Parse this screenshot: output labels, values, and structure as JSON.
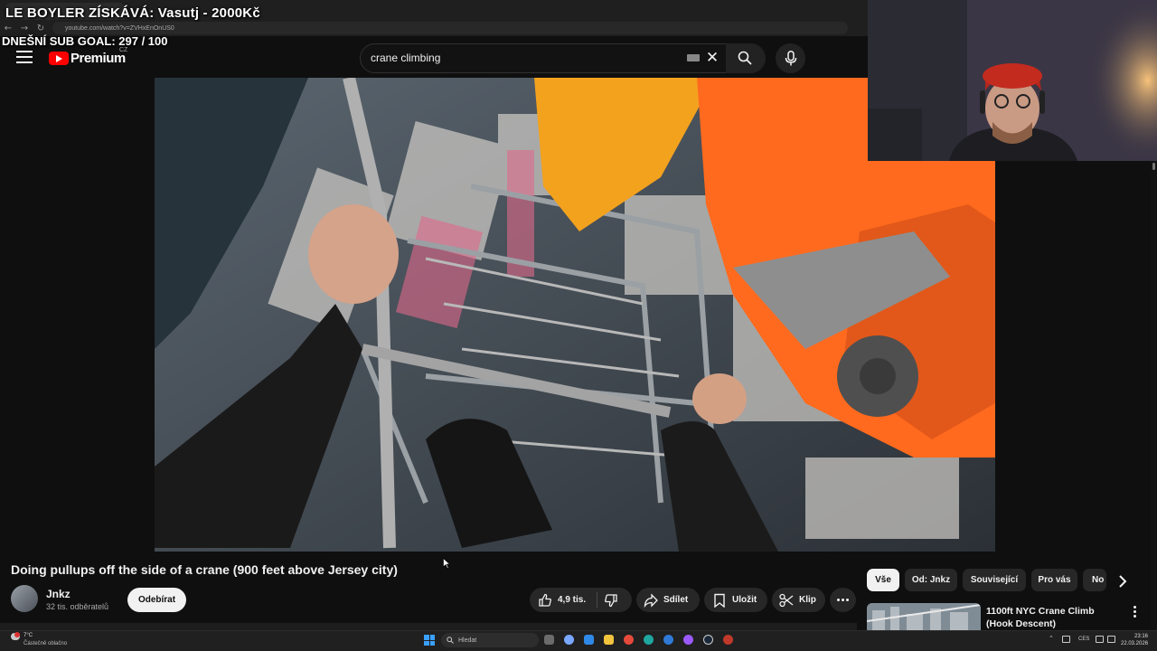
{
  "overlay": {
    "title": "LE BOYLER ZÍSKÁVÁ: Vasutj - 2000Kč",
    "goal": "DNEŠNÍ SUB GOAL:  297 / 100"
  },
  "browser": {
    "url": "youtube.com/watch?v=ZVHxEnOnUS0"
  },
  "header": {
    "logo_text": "Premium",
    "logo_country": "CZ",
    "search_value": "crane climbing"
  },
  "video": {
    "title": "Doing pullups off the side of a crane (900 feet above Jersey city)",
    "channel": "Jnkz",
    "subscribers": "32 tis. odběratelů",
    "subscribe_label": "Odebírat",
    "likes": "4,9 tis.",
    "share_label": "Sdílet",
    "save_label": "Uložit",
    "clip_label": "Klip"
  },
  "filters": {
    "all": "Vše",
    "from_author": "Od: Jnkz",
    "related": "Související",
    "for_you": "Pro vás",
    "more": "No"
  },
  "recommendation": {
    "title": "1100ft NYC Crane Climb (Hook Descent)"
  },
  "taskbar": {
    "weather_temp": "7°C",
    "weather_desc": "Částečně oblačno",
    "search_placeholder": "Hledat",
    "language": "CES",
    "time": "23:16",
    "date": "22.03.2026"
  },
  "colors": {
    "accent": "#ff0000",
    "background": "#0f0f0f",
    "crane_orange": "#ff6a1e"
  },
  "icons": [
    "menu-icon",
    "youtube-logo-icon",
    "keyboard-icon",
    "clear-icon",
    "search-icon",
    "mic-icon",
    "like-icon",
    "dislike-icon",
    "share-icon",
    "save-icon",
    "clip-icon",
    "more-icon",
    "chevron-right-icon"
  ]
}
